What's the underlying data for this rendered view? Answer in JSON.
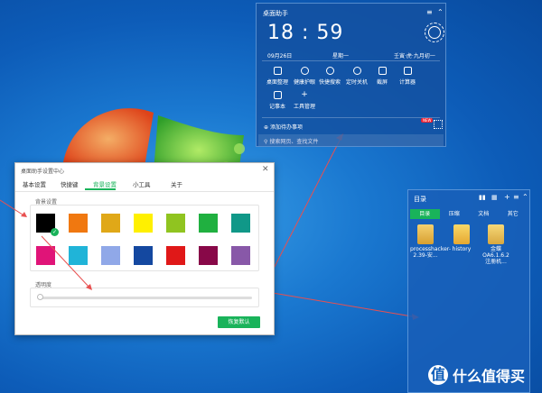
{
  "widget": {
    "title": "桌面助手",
    "time": "18 : 59",
    "date": "09月26日",
    "weekday": "星期一",
    "lunar": "壬寅·虎·九月初一",
    "tools": [
      "桌面整理",
      "健康护眼",
      "快捷搜索",
      "定时关机",
      "截屏",
      "计算器",
      "记事本",
      "工具管理"
    ],
    "add_todo": "添加待办事项",
    "new_badge": "NEW",
    "search_placeholder": "搜索网页、查找文件"
  },
  "directory": {
    "title": "目录",
    "tabs": [
      "目录",
      "压缩",
      "文档",
      "其它"
    ],
    "active_tab": 0,
    "files": [
      {
        "name": "processhacker-2.39-安...",
        "color": "#e8c050"
      },
      {
        "name": "history",
        "color": "#f2c24a"
      },
      {
        "name": "金蝶OA6.1.6.2注册机...",
        "color": "#e9c860"
      }
    ]
  },
  "dialog": {
    "title": "桌面助手设置中心",
    "nav": [
      "基本设置",
      "快捷键",
      "背景设置",
      "小工具",
      "关于"
    ],
    "active_nav": 2,
    "bg_section_label": "背景设置",
    "opacity_label": "透明度",
    "opacity_value": 0,
    "reset_label": "恢复默认",
    "colors": [
      "#000000",
      "#f07810",
      "#e0a818",
      "#fff000",
      "#90c420",
      "#20b040",
      "#109888",
      "#e01478",
      "#20b4d8",
      "#90a8e8",
      "#1448a0",
      "#e01818",
      "#880848",
      "#8858a8"
    ],
    "selected_color": 0
  },
  "watermark": {
    "text": "什么值得买",
    "icon": "值"
  }
}
